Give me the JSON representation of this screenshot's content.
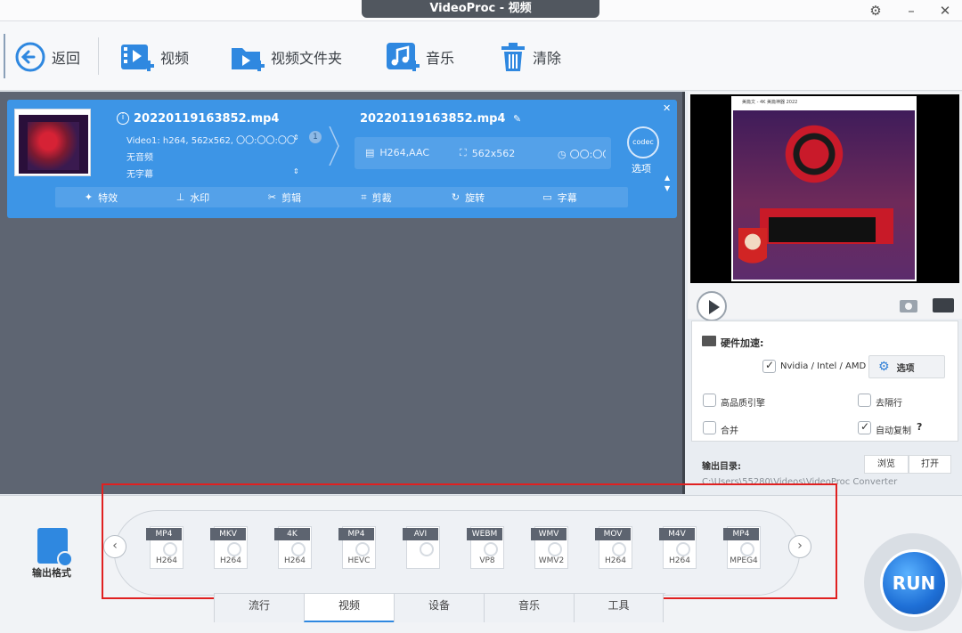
{
  "window": {
    "title": "VideoProc - 视频"
  },
  "toolbar": {
    "back_label": "返回",
    "video_label": "视频",
    "folder_label": "视频文件夹",
    "music_label": "音乐",
    "clear_label": "清除"
  },
  "file": {
    "name": "20220119163852.mp4",
    "video_track": "Video1: h264, 562x562, 〇〇:〇〇:〇〇",
    "audio_track": "无音频",
    "subtitle_track": "无字幕",
    "track_count": "1",
    "output_name": "20220119163852.mp4",
    "output_codec": "H264,AAC",
    "output_resolution": "562x562",
    "output_duration": "〇〇:〇〇:〇〇",
    "codec_badge": "codec",
    "codec_label": "选项"
  },
  "effects": [
    "特效",
    "水印",
    "剪辑",
    "剪裁",
    "旋转",
    "字幕"
  ],
  "preview": {
    "inner_title": "美篇文 - 4K 美篇神器 2022"
  },
  "settings": {
    "hw_label": "硬件加速:",
    "gpu_label": "Nvidia / Intel / AMD",
    "gpu_checked": true,
    "options_label": "选项",
    "hq_label": "高品质引擎",
    "hq_checked": false,
    "deinterlace_label": "去隔行",
    "deinterlace_checked": false,
    "merge_label": "合并",
    "merge_checked": false,
    "autocopy_label": "自动复制",
    "autocopy_help": "?",
    "autocopy_checked": true
  },
  "output_dir": {
    "label": "输出目录:",
    "browse_label": "浏览",
    "open_label": "打开",
    "path": "C:\\Users\\55280\\Videos\\VideoProc Converter"
  },
  "format_panel": {
    "label": "输出格式",
    "formats": [
      {
        "tag": "MP4",
        "codec": "H264"
      },
      {
        "tag": "MKV",
        "codec": "H264"
      },
      {
        "tag": "4K",
        "codec": "H264"
      },
      {
        "tag": "MP4",
        "codec": "HEVC"
      },
      {
        "tag": "AVI",
        "codec": ""
      },
      {
        "tag": "WEBM",
        "codec": "VP8"
      },
      {
        "tag": "WMV",
        "codec": "WMV2"
      },
      {
        "tag": "MOV",
        "codec": "H264"
      },
      {
        "tag": "M4V",
        "codec": "H264"
      },
      {
        "tag": "MP4",
        "codec": "MPEG4"
      }
    ],
    "prev_label": "‹",
    "next_label": "›"
  },
  "bottom_tabs": [
    "流行",
    "视频",
    "设备",
    "音乐",
    "工具"
  ],
  "active_bottom_tab": "视频",
  "run_label": "RUN",
  "colors": {
    "accent": "#2f88e0",
    "card": "#3d95e6",
    "highlight": "#e02020"
  }
}
